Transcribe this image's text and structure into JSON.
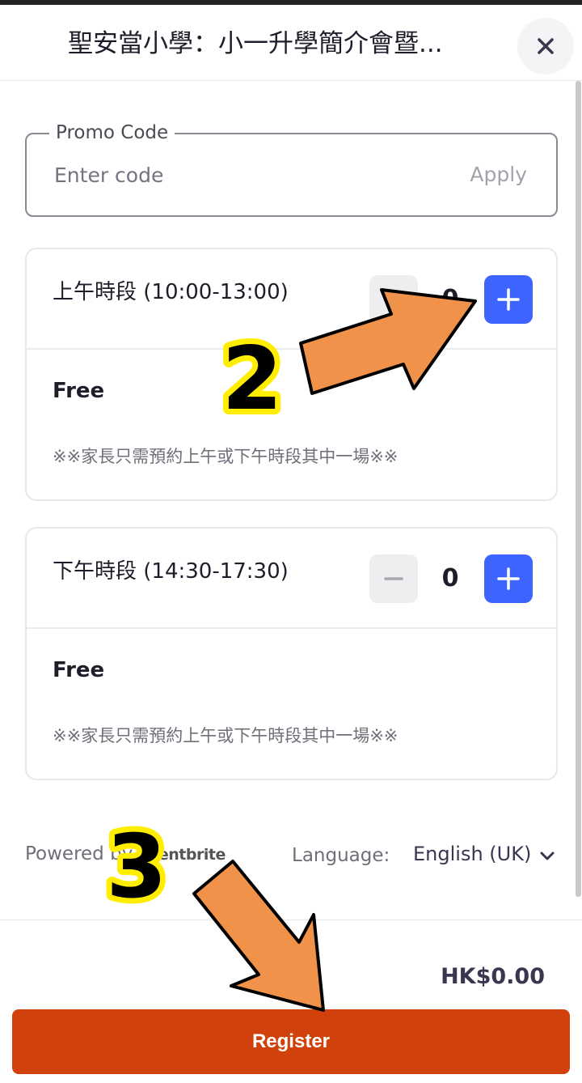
{
  "header": {
    "title": "聖安當小學：小一升學簡介會暨...",
    "close_icon": "close-icon"
  },
  "promo": {
    "legend": "Promo Code",
    "placeholder": "Enter code",
    "value": "",
    "apply_label": "Apply"
  },
  "tickets": [
    {
      "name": "上午時段 (10:00-13:00)",
      "quantity": "0",
      "price": "Free",
      "note": "※※家長只需預約上午或下午時段其中一場※※"
    },
    {
      "name": "下午時段 (14:30-17:30)",
      "quantity": "0",
      "price": "Free",
      "note": "※※家長只需預約上午或下午時段其中一場※※"
    }
  ],
  "footer": {
    "powered_by": "Powered by",
    "powered_logo": "eventbrite",
    "language_label": "Language:",
    "language_value": "English (UK)"
  },
  "checkout": {
    "total": "HK$0.00",
    "register_label": "Register"
  },
  "annotations": {
    "step_2": "2",
    "step_3": "3"
  },
  "colors": {
    "accent_blue": "#3d64ff",
    "register_orange": "#d1410c",
    "arrow_orange": "#f0924a",
    "step_yellow": "#ffee00"
  }
}
